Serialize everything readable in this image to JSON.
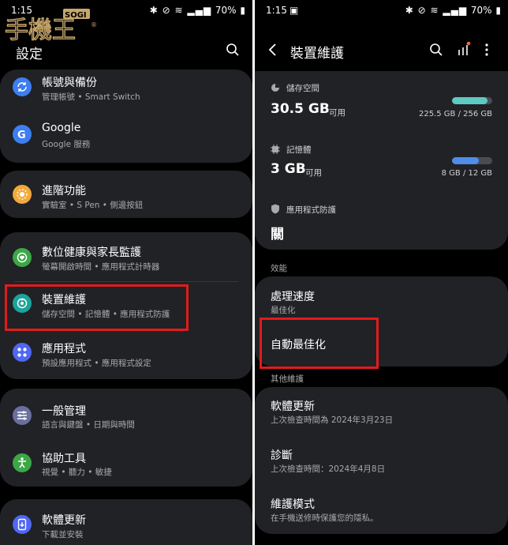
{
  "left": {
    "status": {
      "time": "1:15",
      "icons": "bluetooth mute wifi call signal",
      "battery": "70%"
    },
    "watermark": {
      "text": "手機王",
      "badge": "SOGI",
      "registered": "®"
    },
    "title": "設定",
    "search_icon": "search-icon",
    "groups": [
      {
        "items": [
          {
            "title": "帳號與備份",
            "sub": "管理帳號 • Smart Switch",
            "icon": "sync-icon",
            "color": "#3d7ef2"
          },
          {
            "title": "Google",
            "sub": "Google 服務",
            "icon": "google-icon",
            "color": "#3d7ef2"
          }
        ]
      },
      {
        "items": [
          {
            "title": "進階功能",
            "sub": "實驗室 • S Pen • 側邊按鈕",
            "icon": "advanced-features-icon",
            "color": "#f2a93b"
          }
        ]
      },
      {
        "items": [
          {
            "title": "數位健康與家長監護",
            "sub": "螢幕開啟時間 • 應用程式計時器",
            "icon": "digital-wellbeing-icon",
            "color": "#3da746"
          },
          {
            "title": "裝置維護",
            "sub": "儲存空間 • 記憶體 • 應用程式防護",
            "icon": "device-care-icon",
            "color": "#1ca39a"
          },
          {
            "title": "應用程式",
            "sub": "預設應用程式 • 應用程式設定",
            "icon": "apps-icon",
            "color": "#4f67f2"
          }
        ]
      },
      {
        "items": [
          {
            "title": "一般管理",
            "sub": "語言與鍵盤 • 日期與時間",
            "icon": "sliders-icon",
            "color": "#6a6fa0"
          },
          {
            "title": "協助工具",
            "sub": "視覺 • 聽力 • 敏捷",
            "icon": "accessibility-icon",
            "color": "#3da746"
          }
        ]
      },
      {
        "items": [
          {
            "title": "軟體更新",
            "sub": "下載並安裝",
            "icon": "software-update-icon",
            "color": "#4f67f2"
          }
        ]
      }
    ]
  },
  "right": {
    "status": {
      "time": "1:15",
      "icons": "bluetooth mute wifi call signal",
      "battery": "70%"
    },
    "title": "裝置維護",
    "back_icon": "back-arrow-icon",
    "search_icon": "search-icon",
    "stats_icon": "stats-icon",
    "more_icon": "more-vert-icon",
    "storage": {
      "label": "儲存空間",
      "value": "30.5 GB",
      "unit": "可用",
      "detail": "225.5 GB / 256 GB",
      "used_fraction": 0.88,
      "color": "#5ec9c3"
    },
    "memory": {
      "label": "記憶體",
      "value": "3 GB",
      "unit": "可用",
      "detail": "8 GB / 12 GB",
      "used_fraction": 0.67,
      "color": "#4f8de8"
    },
    "protection": {
      "label": "應用程式防護",
      "value": "關"
    },
    "performance_section": "效能",
    "processing_speed": {
      "title": "處理速度",
      "sub": "最佳化"
    },
    "auto_optimize": {
      "title": "自動最佳化"
    },
    "other_section": "其他維護",
    "software_update": {
      "title": "軟體更新",
      "sub": "上次檢查時間為 2024年3月23日"
    },
    "diagnostics": {
      "title": "診斷",
      "sub": "上次檢查時間：2024年4月8日"
    },
    "maintenance_mode": {
      "title": "維護模式",
      "sub": "在手機送修時保護您的隱私。"
    }
  }
}
